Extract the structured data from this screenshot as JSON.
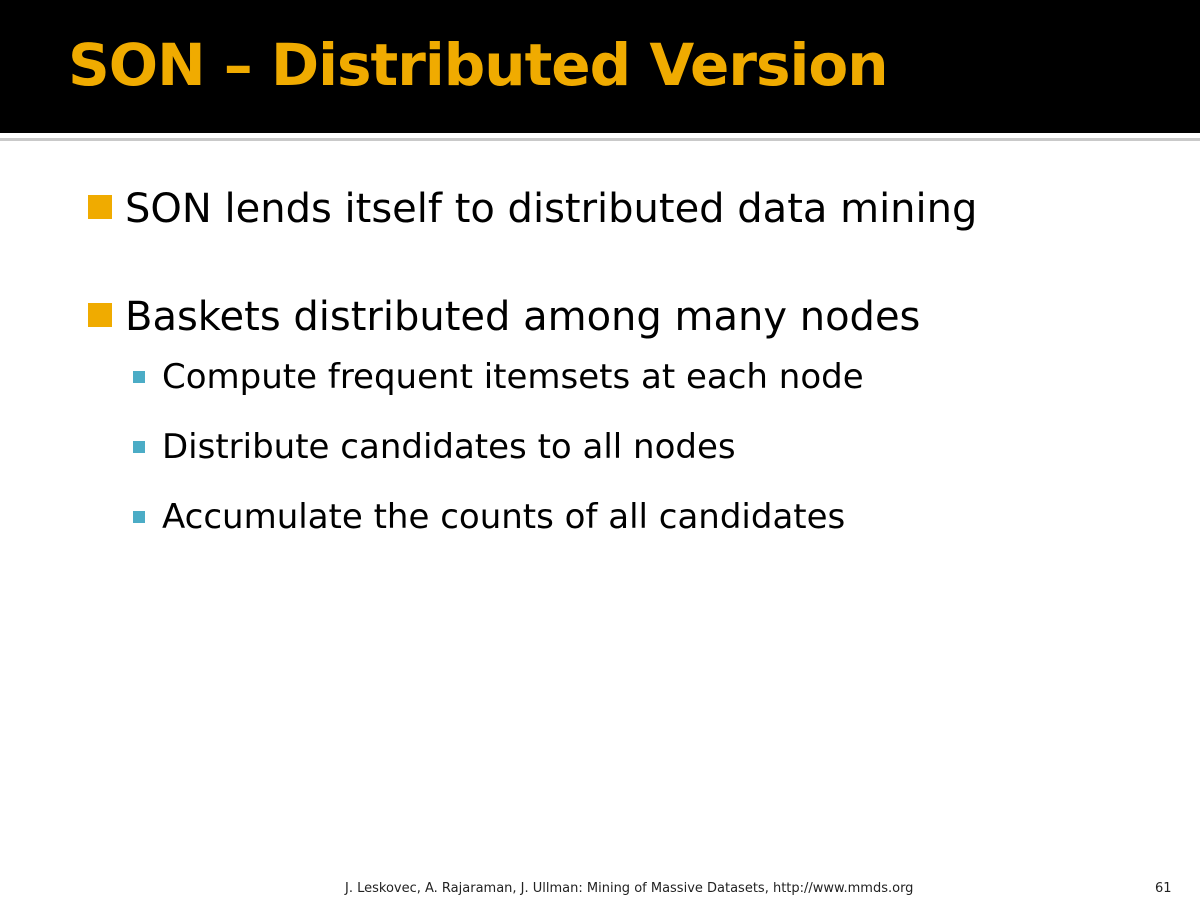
{
  "slide": {
    "title": "SON – Distributed Version",
    "bullets": [
      {
        "text": "SON lends itself to distributed data mining",
        "children": []
      },
      {
        "text": "Baskets distributed among many nodes",
        "children": [
          "Compute frequent itemsets at each node",
          "Distribute candidates to all nodes",
          "Accumulate the counts of all candidates"
        ]
      }
    ],
    "footer": "J. Leskovec, A. Rajaraman, J. Ullman: Mining of Massive Datasets, http://www.mmds.org",
    "page_number": "61"
  },
  "colors": {
    "title_text": "#F0AB00",
    "title_bar": "#000000",
    "bullet_level1": "#F0AB00",
    "bullet_level2": "#4BACC6"
  },
  "icons": {
    "bullet_level1": "square-bullet-icon",
    "bullet_level2": "small-square-bullet-icon"
  }
}
